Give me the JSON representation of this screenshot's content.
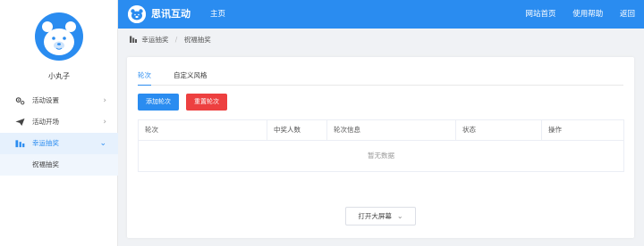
{
  "header": {
    "brand": "思讯互动",
    "home_link": "主页",
    "links": [
      "网站首页",
      "使用帮助",
      "返回"
    ],
    "color": "#2a8cf0"
  },
  "sidebar": {
    "user_name": "小丸子",
    "menu": [
      {
        "label": "活动设置",
        "icon": "gear-icon"
      },
      {
        "label": "活动开场",
        "icon": "paper-plane-icon"
      },
      {
        "label": "幸运抽奖",
        "icon": "chart-icon",
        "active": true
      }
    ],
    "sub_item": "祝福抽奖"
  },
  "breadcrumb": {
    "items": [
      "幸运抽奖",
      "祝福抽奖"
    ],
    "separator": "/"
  },
  "main": {
    "tabs": [
      "轮次",
      "自定义风格"
    ],
    "buttons": {
      "add": "添加轮次",
      "reset": "重置轮次"
    },
    "table": {
      "columns": [
        "轮次",
        "中奖人数",
        "轮次信息",
        "状态",
        "操作"
      ],
      "empty_text": "暂无数据"
    },
    "screen_button": "打开大屏幕",
    "colors": {
      "accent": "#2a8cf0",
      "danger": "#ed4040"
    }
  }
}
